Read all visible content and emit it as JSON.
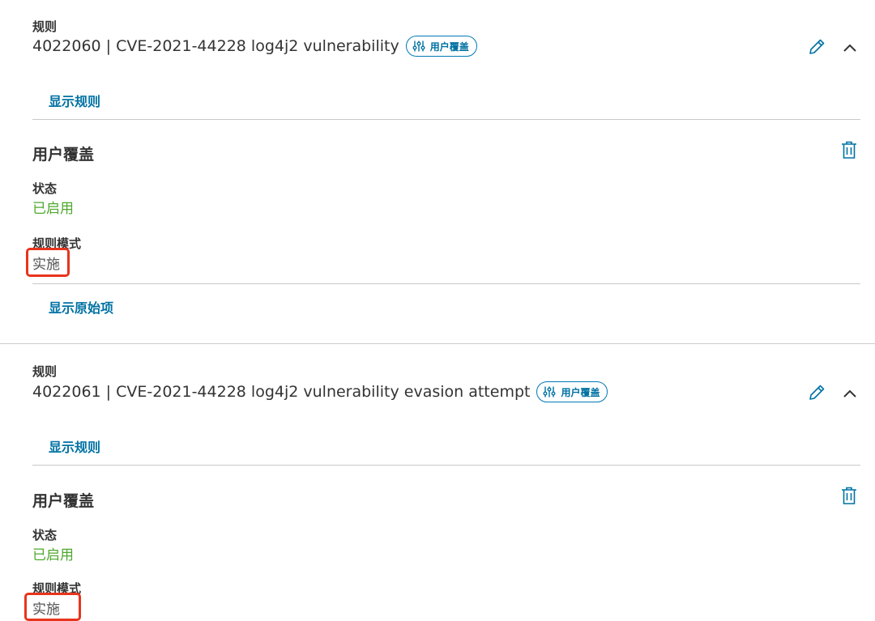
{
  "rules": [
    {
      "rule_label": "规则",
      "rule_title": "4022060 | CVE-2021-44228 log4j2 vulnerability",
      "badge": "用户覆盖",
      "show_rule": "显示规则",
      "override_title": "用户覆盖",
      "status_label": "状态",
      "status_value": "已启用",
      "mode_label": "规则模式",
      "mode_value": "实施",
      "show_original": "显示原始项"
    },
    {
      "rule_label": "规则",
      "rule_title": "4022061 | CVE-2021-44228 log4j2 vulnerability evasion attempt",
      "badge": "用户覆盖",
      "show_rule": "显示规则",
      "override_title": "用户覆盖",
      "status_label": "状态",
      "status_value": "已启用",
      "mode_label": "规则模式",
      "mode_value": "实施"
    }
  ],
  "colors": {
    "accent": "#0072a3",
    "status_enabled": "#4fa82e",
    "highlight": "#e8341c",
    "divider": "#c8c8c8"
  },
  "icons": {
    "badge": "sliders-icon",
    "edit": "pencil-icon",
    "collapse": "chevron-up-icon",
    "delete": "trash-icon"
  }
}
